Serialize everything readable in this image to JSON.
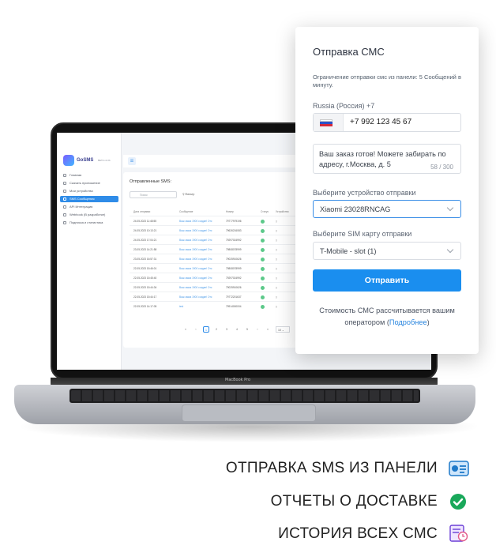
{
  "laptop": {
    "brand": "MacBook Pro",
    "app": {
      "logo_text": "GoSMS",
      "version": "BETA v1.0b",
      "menu": [
        {
          "label": "Главная",
          "active": false
        },
        {
          "label": "Скачать приложение",
          "active": false
        },
        {
          "label": "Мои устройства",
          "active": false
        },
        {
          "label": "SMS Сообщения",
          "active": true
        },
        {
          "label": "API Интеграция",
          "active": false
        },
        {
          "label": "Webhook (В разработке)",
          "active": false
        },
        {
          "label": "Подписка и статистика",
          "active": false
        }
      ],
      "card_title": "Отправленные SMS:",
      "search_placeholder": "Поиск",
      "filter_label": "Фильтр",
      "columns": [
        "Дата отправки",
        "Сообщение",
        "Номер",
        "Статус",
        "Устройство"
      ],
      "rows": [
        {
          "date": "24.05.2023 11:48:55",
          "msg": "Ваш заказ 1900 создан! Отс",
          "num": "79777979196"
        },
        {
          "date": "24.05.2023 10:13:21",
          "msg": "Ваш заказ 1900 создан! Отс",
          "num": "79626216083"
        },
        {
          "date": "24.05.2023 17:04:21",
          "msg": "Ваш заказ 1900 создан! Отс",
          "num": "79297024992"
        },
        {
          "date": "23.05.2023 14:21:58",
          "msg": "Ваш заказ 1900 создан! Отс",
          "num": "79808078999"
        },
        {
          "date": "23.05.2023 16:57:31",
          "msg": "Ваш заказ 1900 создан! Отс",
          "num": "79025910626"
        },
        {
          "date": "22.05.2023 15:46:01",
          "msg": "Ваш заказ 1900 создан! Отс",
          "num": "79808078999"
        },
        {
          "date": "22.05.2023 15:45:40",
          "msg": "Ваш заказ 1900 создан! Отс",
          "num": "79297024992"
        },
        {
          "date": "22.05.2023 15:44:34",
          "msg": "Ваш заказ 1900 создан! Отс",
          "num": "79025910626"
        },
        {
          "date": "22.05.2023 15:44:17",
          "msg": "Ваш заказ 1900 создан! Отс",
          "num": "79772201637"
        },
        {
          "date": "22.05.2023 14:17:05",
          "msg": "test",
          "num": "79914000004"
        }
      ],
      "pages": [
        "«",
        "‹",
        "1",
        "2",
        "3",
        "4",
        "5",
        "›",
        "»"
      ],
      "active_page": "1",
      "page_size": "10"
    }
  },
  "modal": {
    "title": "Отправка СМС",
    "note": "Ограничение отправки смс из панели: 5 Сообщений в минуту.",
    "country_label": "Russia (Россия) +7",
    "phone": "+7 992 123 45 67",
    "message": "Ваш заказ готов! Можете забирать по адресу, г.Москва, д. 5",
    "char_count": "58 / 300",
    "device_label": "Выберите устройство отправки",
    "device_value": "Xiaomi 23028RNCAG",
    "sim_label": "Выберите SIM карту отправки",
    "sim_value": "T-Mobile - slot (1)",
    "send_button": "Отправить",
    "cost_text": "Стоимость СМС рассчитывается вашим оператором (",
    "cost_link": "Подробнее",
    "cost_close": ")"
  },
  "features": [
    {
      "label": "ОТПРАВКА SMS ИЗ ПАНЕЛИ",
      "icon": "sms-panel-icon"
    },
    {
      "label": "ОТЧЕТЫ О ДОСТАВКЕ",
      "icon": "check-circle-icon"
    },
    {
      "label": "ИСТОРИЯ ВСЕХ СМС",
      "icon": "history-icon"
    }
  ],
  "colors": {
    "accent": "#1a8eef",
    "success": "#19a85a",
    "link": "#2a86df"
  }
}
